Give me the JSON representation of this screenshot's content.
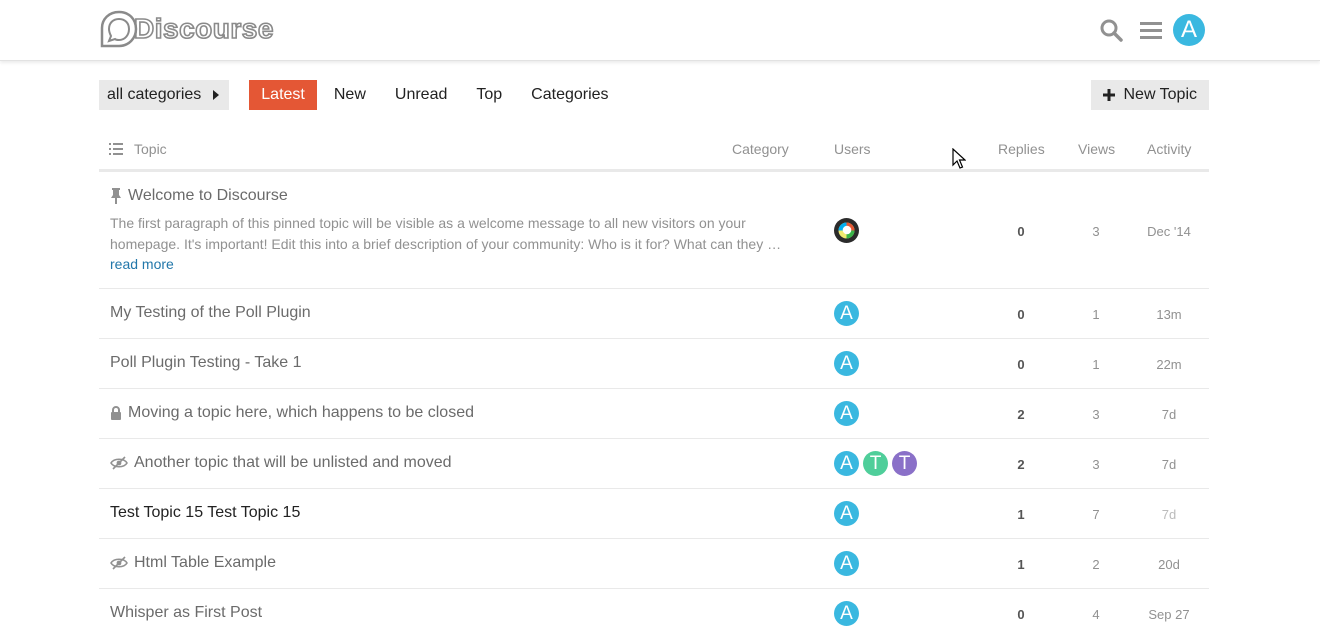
{
  "app": {
    "logo_text": "Discourse"
  },
  "header": {
    "avatar_letter": "A",
    "avatar_color": "#3ab8e0"
  },
  "nav": {
    "category_dropdown": "all categories",
    "items": [
      "Latest",
      "New",
      "Unread",
      "Top",
      "Categories"
    ],
    "active": "Latest",
    "new_topic_label": "New Topic"
  },
  "table": {
    "headers": {
      "topic": "Topic",
      "category": "Category",
      "users": "Users",
      "replies": "Replies",
      "views": "Views",
      "activity": "Activity"
    },
    "rows": [
      {
        "icon": "pin-icon",
        "title": "Welcome to Discourse",
        "excerpt": "The first paragraph of this pinned topic will be visible as a welcome message to all new visitors on your homepage. It's important! Edit this into a brief description of your community: Who is it for? What can they …",
        "read_more": "read more",
        "users": [
          {
            "letter": "",
            "color": "#2b2b2b",
            "kind": "system"
          }
        ],
        "replies": "0",
        "views": "3",
        "activity": "Dec '14"
      },
      {
        "icon": "",
        "title": "My Testing of the Poll Plugin",
        "users": [
          {
            "letter": "A",
            "color": "#3ab8e0"
          }
        ],
        "replies": "0",
        "views": "1",
        "activity": "13m"
      },
      {
        "icon": "",
        "title": "Poll Plugin Testing - Take 1",
        "users": [
          {
            "letter": "A",
            "color": "#3ab8e0"
          }
        ],
        "replies": "0",
        "views": "1",
        "activity": "22m"
      },
      {
        "icon": "lock-icon",
        "title": "Moving a topic here, which happens to be closed",
        "users": [
          {
            "letter": "A",
            "color": "#3ab8e0"
          }
        ],
        "replies": "2",
        "views": "3",
        "activity": "7d"
      },
      {
        "icon": "unlisted-eye-icon",
        "title": "Another topic that will be unlisted and moved",
        "users": [
          {
            "letter": "A",
            "color": "#3ab8e0"
          },
          {
            "letter": "T",
            "color": "#4fce9a"
          },
          {
            "letter": "T",
            "color": "#8a70c8"
          }
        ],
        "replies": "2",
        "views": "3",
        "activity": "7d"
      },
      {
        "icon": "",
        "title": "Test Topic 15 Test Topic 15",
        "unvisited": true,
        "users": [
          {
            "letter": "A",
            "color": "#3ab8e0"
          }
        ],
        "replies": "1",
        "views": "7",
        "activity": "7d",
        "activity_faint": true
      },
      {
        "icon": "unlisted-eye-icon",
        "title": "Html Table Example",
        "users": [
          {
            "letter": "A",
            "color": "#3ab8e0"
          }
        ],
        "replies": "1",
        "views": "2",
        "activity": "20d"
      },
      {
        "icon": "",
        "title": "Whisper as First Post",
        "users": [
          {
            "letter": "A",
            "color": "#3ab8e0"
          }
        ],
        "replies": "0",
        "views": "4",
        "activity": "Sep 27"
      }
    ]
  },
  "colors": {
    "accent": "#e45735",
    "link": "#2277aa"
  }
}
